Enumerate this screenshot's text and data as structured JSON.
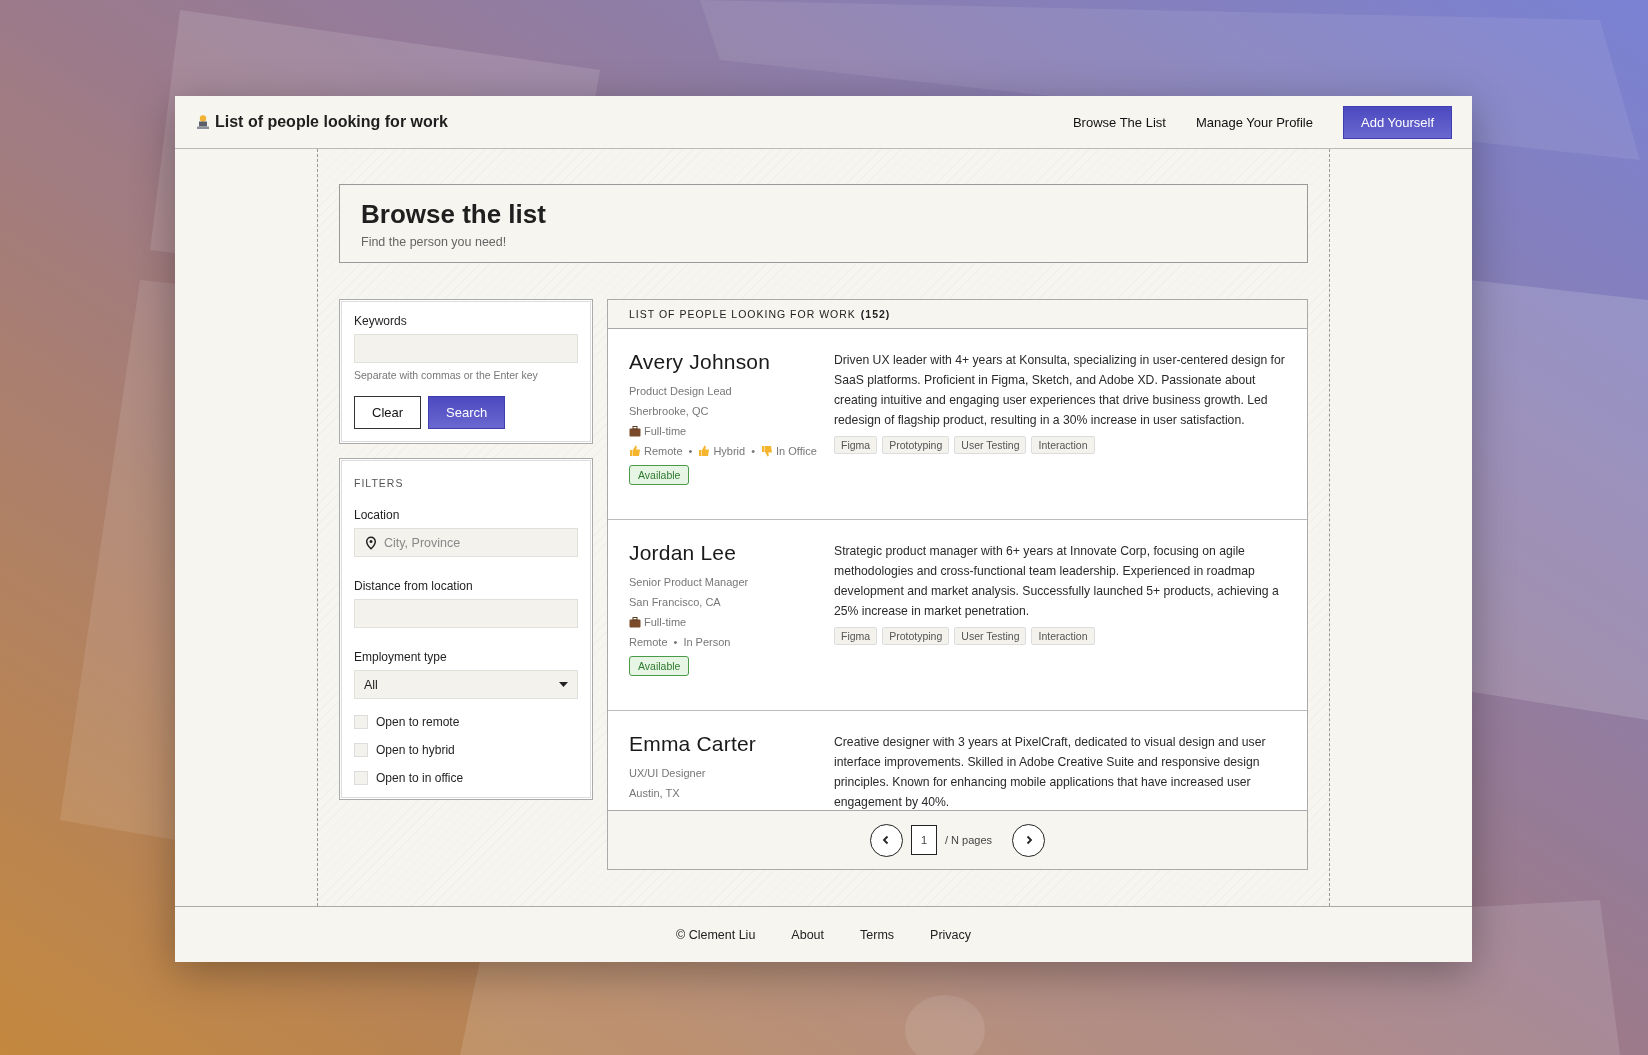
{
  "header": {
    "title": "List of people looking for work",
    "nav": [
      {
        "label": "Browse The List",
        "kind": "link"
      },
      {
        "label": "Manage Your Profile",
        "kind": "link"
      },
      {
        "label": "Add Yourself",
        "kind": "primary"
      }
    ]
  },
  "heading": {
    "title": "Browse the list",
    "subtitle": "Find the person you need!"
  },
  "search": {
    "label": "Keywords",
    "hint": "Separate with commas or the Enter key",
    "buttons": [
      {
        "label": "Clear",
        "kind": "secondary"
      },
      {
        "label": "Search",
        "kind": "primary"
      }
    ]
  },
  "filters": {
    "heading": "FILTERS",
    "location": {
      "label": "Location",
      "placeholder": "City, Province"
    },
    "distance": {
      "label": "Distance from location"
    },
    "employment": {
      "label": "Employment type",
      "value": "All"
    },
    "options": [
      {
        "label": "Open to remote",
        "checked": false
      },
      {
        "label": "Open to hybrid",
        "checked": false
      },
      {
        "label": "Open to in office",
        "checked": false
      }
    ]
  },
  "list": {
    "heading": "LIST OF PEOPLE LOOKING FOR WORK",
    "count": "(152)",
    "people": [
      {
        "name": "Avery Johnson",
        "role": "Product Design Lead",
        "location": "Sherbrooke, QC",
        "employment": "Full-time",
        "work_modes": [
          {
            "label": "Remote",
            "kind": "liked"
          },
          {
            "label": "Hybrid",
            "kind": "liked"
          },
          {
            "label": "In Office",
            "kind": "disliked"
          }
        ],
        "separator": "•",
        "status": "Available",
        "bio": "Driven UX leader with 4+ years at Konsulta, specializing in user-centered design for SaaS platforms. Proficient in Figma, Sketch, and Adobe XD. Passionate about creating intuitive and engaging user experiences that drive business growth. Led redesign of flagship product, resulting in a 30% increase in user satisfaction.",
        "skills": [
          "Figma",
          "Prototyping",
          "User Testing",
          "Interaction"
        ]
      },
      {
        "name": "Jordan Lee",
        "role": "Senior Product Manager",
        "location": "San Francisco, CA",
        "employment": "Full-time",
        "work_modes": [
          {
            "label": "Remote",
            "kind": "plain"
          },
          {
            "label": "In Person",
            "kind": "plain"
          }
        ],
        "separator": "•",
        "status": "Available",
        "bio": "Strategic product manager with 6+ years at Innovate Corp, focusing on agile methodologies and cross-functional team leadership. Experienced in roadmap development and market analysis. Successfully launched 5+ products, achieving a 25% increase in market penetration.",
        "skills": [
          "Figma",
          "Prototyping",
          "User Testing",
          "Interaction"
        ]
      },
      {
        "name": "Emma Carter",
        "role": "UX/UI Designer",
        "location": "Austin, TX",
        "bio": "Creative designer with 3 years at PixelCraft, dedicated to visual design and user interface improvements. Skilled in Adobe Creative Suite and responsive design principles. Known for enhancing mobile applications that have increased user engagement by 40%."
      }
    ]
  },
  "pagination": {
    "page": "1",
    "total": "/ N pages"
  },
  "footer": {
    "copyright": "© Clement Liu",
    "links": [
      "About",
      "Terms",
      "Privacy"
    ]
  }
}
